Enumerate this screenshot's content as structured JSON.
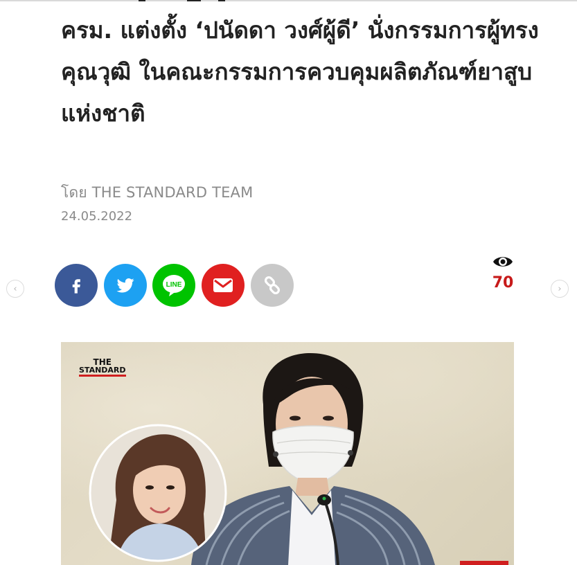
{
  "article": {
    "headline": "ครม. แต่งตั้ง ‘ปนัดดา วงศ์ผู้ดี’ นั่งกรรมการผู้ทรงคุณวุฒิ ในคณะกรรมการควบคุมผลิตภัณฑ์ยาสูบแห่งชาติ",
    "author": "โดย THE STANDARD TEAM",
    "date": "24.05.2022"
  },
  "share": [
    {
      "name": "facebook",
      "color": "#3b5998",
      "icon": "facebook-icon"
    },
    {
      "name": "twitter",
      "color": "#1da1f2",
      "icon": "twitter-icon"
    },
    {
      "name": "line",
      "color": "#00c300",
      "icon": "line-icon",
      "label": "LINE"
    },
    {
      "name": "email",
      "color": "#e02020",
      "icon": "mail-icon"
    },
    {
      "name": "copy-link",
      "color": "#c8c8c8",
      "icon": "link-icon"
    }
  ],
  "views": {
    "count": "70",
    "icon": "eye-icon"
  },
  "nav": {
    "prev": "‹",
    "next": "›"
  },
  "photo": {
    "brand_line1": "THE",
    "brand_line2": "STANDARD"
  },
  "colors": {
    "text": "#222222",
    "meta": "#8a8a8a",
    "views": "#c71a1a",
    "accent": "#d01f1f"
  }
}
